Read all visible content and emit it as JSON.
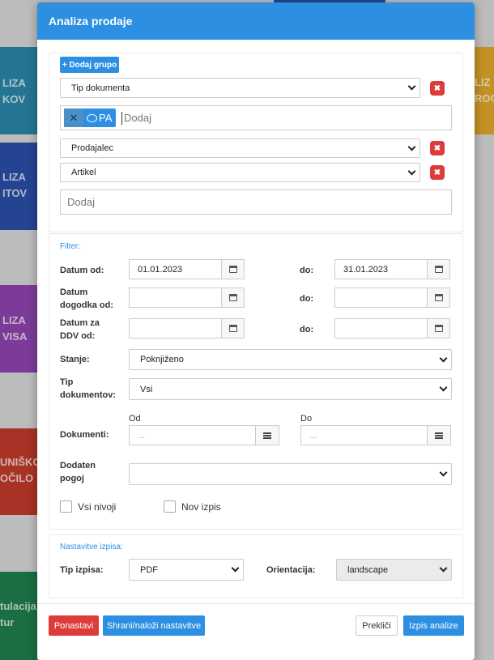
{
  "background_tiles": [
    {
      "text": "LIZA\nKOV",
      "color": "#2a86a6"
    },
    {
      "text": "LIZA\nITOV",
      "color": "#2a4ea6"
    },
    {
      "text": "LIZA\nVISA",
      "color": "#8e44ad"
    },
    {
      "text": "UNIŠKO\nOČILO",
      "color": "#c0392b"
    },
    {
      "text": "tulacija\ntur",
      "color": "#1e7e4a"
    },
    {
      "text": "LIZ\nROC",
      "color": "#e0a52a"
    }
  ],
  "modal": {
    "title": "Analiza prodaje",
    "add_group_label": "+ Dodaj grupo",
    "groups": [
      {
        "value": "Tip dokumenta"
      },
      {
        "value": "Prodajalec"
      },
      {
        "value": "Artikel"
      }
    ],
    "tag": {
      "label": "PA",
      "remove_glyph": "✕"
    },
    "tag_placeholder": "Dodaj",
    "add_placeholder": "Dodaj",
    "remove_glyph": "✖",
    "filter": {
      "header": "Filter:",
      "datum_od_label": "Datum od:",
      "datum_od_value": "01.01.2023",
      "datum_do_value": "31.01.2023",
      "do_label": "do:",
      "dogodek_label": "Datum dogodka od:",
      "ddv_label": "Datum za DDV od:",
      "stanje_label": "Stanje:",
      "stanje_value": "Poknjiženo",
      "tip_label": "Tip dokumentov:",
      "tip_value": "Vsi",
      "dokumenti_label": "Dokumenti:",
      "od_label": "Od",
      "do_upper_label": "Do",
      "doc_placeholder": "...",
      "pogoj_label": "Dodaten pogoj",
      "pogoj_value": "",
      "vsi_nivoji_label": "Vsi nivoji",
      "nov_izpis_label": "Nov izpis"
    },
    "settings": {
      "header": "Nastavitve izpisa:",
      "tip_izpisa_label": "Tip izpisa:",
      "tip_izpisa_value": "PDF",
      "orientacija_label": "Orientacija:",
      "orientacija_value": "landscape"
    },
    "footer": {
      "reset_label": "Ponastavi",
      "save_label": "Shrani/naloži nastavitve",
      "cancel_label": "Prekliči",
      "print_label": "Izpis analize"
    }
  }
}
